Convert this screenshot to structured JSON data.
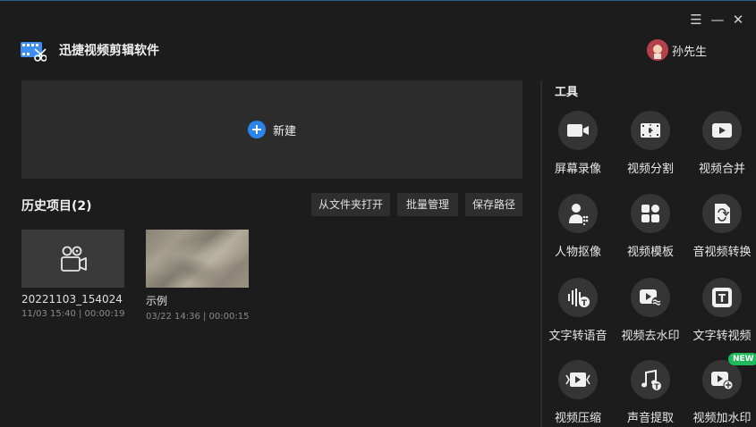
{
  "window": {
    "menu_glyph": "☰",
    "minimize_glyph": "—",
    "close_glyph": "✕"
  },
  "app": {
    "title": "迅捷视频剪辑软件",
    "logo_icon": "film-scissors-logo"
  },
  "user": {
    "name": "孙先生",
    "avatar_icon": "avatar"
  },
  "new_project": {
    "label": "新建"
  },
  "history": {
    "title": "历史项目(2)",
    "buttons": [
      "从文件夹打开",
      "批量管理",
      "保存路径"
    ],
    "projects": [
      {
        "name": "20221103_154024",
        "meta": "11/03 15:40 | 00:00:19",
        "thumb": "video-camera-icon"
      },
      {
        "name": "示例",
        "meta": "03/22 14:36 | 00:00:15",
        "thumb": "desert-photo"
      }
    ]
  },
  "tools": {
    "title": "工具",
    "items": [
      {
        "label": "屏幕录像",
        "icon": "screen-record-icon"
      },
      {
        "label": "视频分割",
        "icon": "video-split-icon"
      },
      {
        "label": "视频合并",
        "icon": "video-merge-icon"
      },
      {
        "label": "人物抠像",
        "icon": "person-cutout-icon"
      },
      {
        "label": "视频模板",
        "icon": "video-template-icon"
      },
      {
        "label": "音视频转换",
        "icon": "av-convert-icon"
      },
      {
        "label": "文字转语音",
        "icon": "text-to-speech-icon"
      },
      {
        "label": "视频去水印",
        "icon": "remove-watermark-icon"
      },
      {
        "label": "文字转视频",
        "icon": "text-to-video-icon"
      },
      {
        "label": "视频压缩",
        "icon": "video-compress-icon"
      },
      {
        "label": "声音提取",
        "icon": "audio-extract-icon"
      },
      {
        "label": "视频加水印",
        "icon": "add-watermark-icon",
        "badge": "NEW"
      }
    ]
  },
  "colors": {
    "background": "#1c1c1c",
    "panel": "#2c2c2c",
    "accent_blue": "#2a84ea",
    "badge_green": "#1fb85a"
  }
}
